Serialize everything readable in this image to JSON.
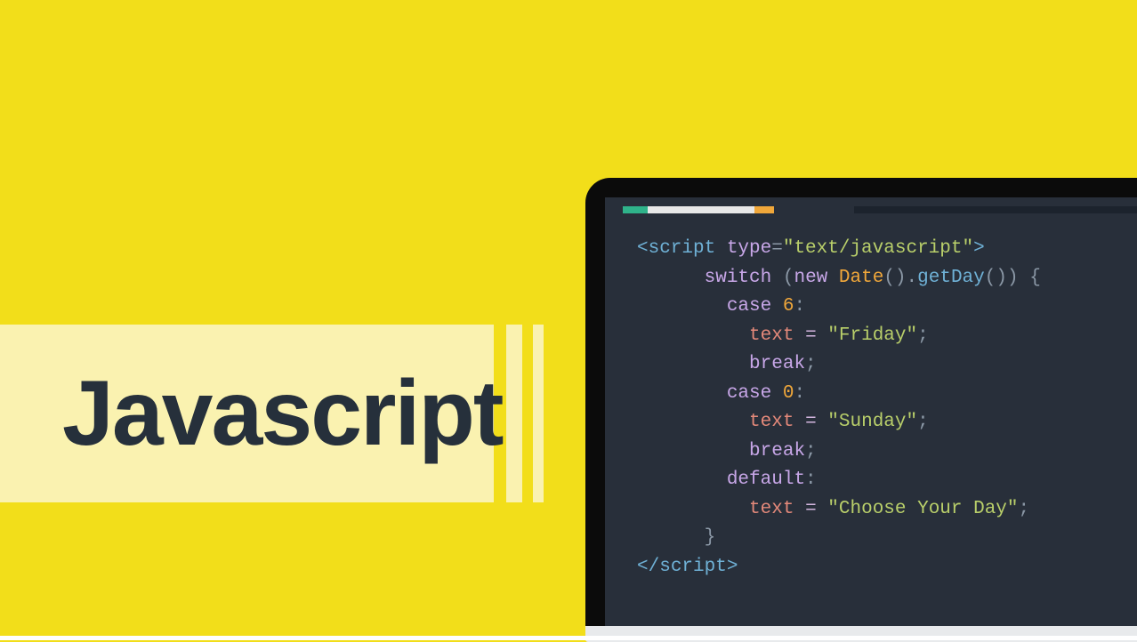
{
  "title": "Javascript",
  "colors": {
    "bg": "#f2de1a",
    "bg_shadow": "#d8c617",
    "band": "#faf2b0",
    "text_dark": "#26303b",
    "editor_bg": "#282f3a"
  },
  "tabs": {
    "green": "#2fb38a",
    "white": "#e8e8e8",
    "orange": "#f0a73a",
    "dark": "#1c232d"
  },
  "code": {
    "l1": {
      "open": "<script",
      "attr": " type",
      "eq": "=",
      "val": "\"text/javascript\"",
      "close": ">"
    },
    "l2": {
      "kw": "switch",
      "p1": " (",
      "kw2": "new",
      "sp": " ",
      "cls": "Date",
      "fn1": "()",
      "dot": ".",
      "fn2": "getDay",
      "fn2p": "()",
      "p2": ") {"
    },
    "l3": {
      "kw": "case",
      "sp": " ",
      "num": "6",
      "colon": ":"
    },
    "l4": {
      "ident": "text",
      "sp": " ",
      "eq": "=",
      "sp2": " ",
      "val": "\"Friday\"",
      "semi": ";"
    },
    "l5": {
      "kw": "break",
      "semi": ";"
    },
    "l6": {
      "kw": "case",
      "sp": " ",
      "num": "0",
      "colon": ":"
    },
    "l7": {
      "ident": "text",
      "sp": " ",
      "eq": "=",
      "sp2": " ",
      "val": "\"Sunday\"",
      "semi": ";"
    },
    "l8": {
      "kw": "break",
      "semi": ";"
    },
    "l9": {
      "kw": "default",
      "colon": ":"
    },
    "l10": {
      "ident": "text",
      "sp": " ",
      "eq": "=",
      "sp2": " ",
      "val": "\"Choose Your Day\"",
      "semi": ";"
    },
    "l11": {
      "brace": "}"
    },
    "l12": {
      "open": "</",
      "tag": "script",
      "close": ">"
    },
    "indent": {
      "i1": "      ",
      "i2": "        ",
      "i3": "          "
    }
  }
}
